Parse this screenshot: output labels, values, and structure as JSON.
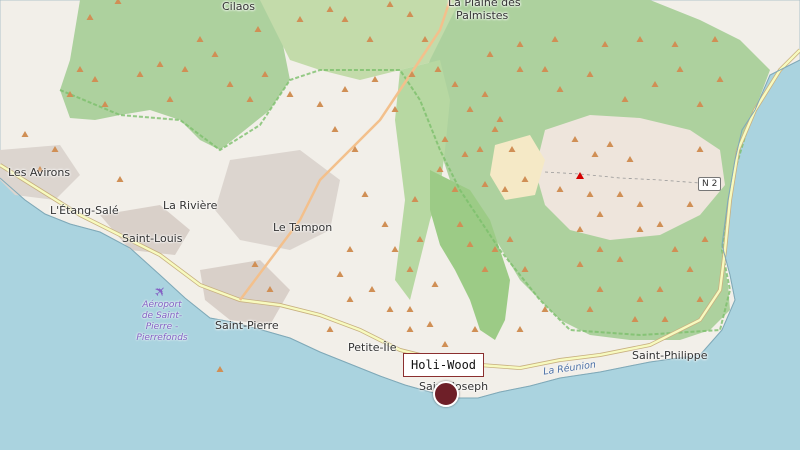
{
  "map": {
    "colors": {
      "sea": "#aad3df",
      "land": "#f2efe9",
      "forest": "#add19e",
      "forest_dark": "#8dc56c",
      "urban": "#d9d0c9",
      "bare_rock": "#eee5dc",
      "scrub": "#c8d7ab",
      "sand": "#f5e9c6",
      "park_border": "#7cbf6b",
      "peak": "#d08f55",
      "volcano": "#d40000",
      "road_major": "#f7fabf",
      "road_casing": "#c8b080",
      "marker": "#6e1f28"
    },
    "places": {
      "cilaos": "Cilaos",
      "plaine_des_palmistes_1": "La Plaine des",
      "plaine_des_palmistes_2": "Palmistes",
      "les_avirons": "Les Avirons",
      "etang_sale": "L'Étang-Salé",
      "la_riviere": "La Rivière",
      "saint_louis": "Saint-Louis",
      "le_tampon": "Le Tampon",
      "saint_pierre": "Saint-Pierre",
      "petite_ile": "Petite-Île",
      "saint_joseph": "Saint-Joseph",
      "saint_philippe": "Saint-Philippe",
      "la_reunion": "La Réunion"
    },
    "airport": {
      "line1": "Aéroport",
      "line2": "de Saint-",
      "line3": "Pierre -",
      "line4": "Pierrefonds",
      "icon": "airplane-icon"
    },
    "road_shield": "N 2",
    "marker": {
      "label": "Holi-Wood",
      "icon": "location-pin-icon"
    }
  }
}
